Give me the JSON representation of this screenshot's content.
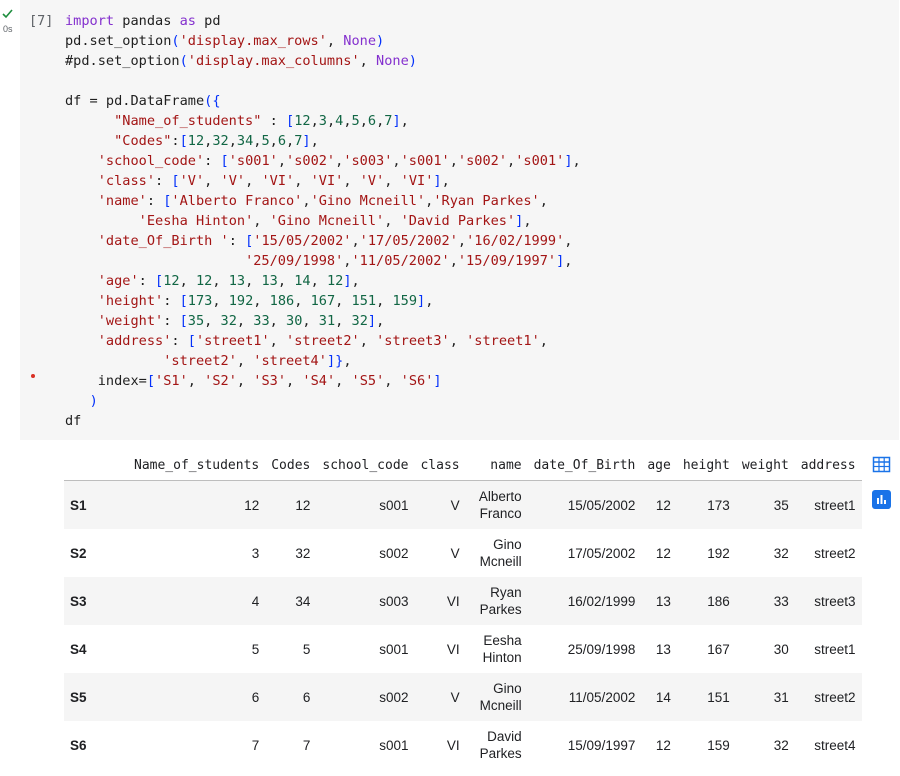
{
  "cell": {
    "status_icon": "check-icon",
    "run_time": "0s",
    "execution_count": "[7]",
    "code_lines": [
      "import pandas as pd",
      "pd.set_option('display.max_rows', None)",
      "#pd.set_option('display.max_columns', None)",
      "",
      "df = pd.DataFrame({",
      "      \"Name_of_students\" : [12,3,4,5,6,7],",
      "      \"Codes\":[12,32,34,5,6,7],",
      "    'school_code': ['s001','s002','s003','s001','s002','s001'],",
      "    'class': ['V', 'V', 'VI', 'VI', 'V', 'VI'],",
      "    'name': ['Alberto Franco','Gino Mcneill','Ryan Parkes',",
      "         'Eesha Hinton', 'Gino Mcneill', 'David Parkes'],",
      "    'date_Of_Birth ': ['15/05/2002','17/05/2002','16/02/1999',",
      "                      '25/09/1998','11/05/2002','15/09/1997'],",
      "    'age': [12, 12, 13, 13, 14, 12],",
      "    'height': [173, 192, 186, 167, 151, 159],",
      "    'weight': [35, 32, 33, 30, 31, 32],",
      "    'address': ['street1', 'street2', 'street3', 'street1',",
      "            'street2', 'street4']},",
      "    index=['S1', 'S2', 'S3', 'S4', 'S5', 'S6']",
      "   )",
      "df"
    ]
  },
  "output": {
    "columns": [
      "Name_of_students",
      "Codes",
      "school_code",
      "class",
      "name",
      "date_Of_Birth",
      "age",
      "height",
      "weight",
      "address"
    ],
    "rows": [
      {
        "index": "S1",
        "cells": [
          "12",
          "12",
          "s001",
          "V",
          "Alberto Franco",
          "15/05/2002",
          "12",
          "173",
          "35",
          "street1"
        ]
      },
      {
        "index": "S2",
        "cells": [
          "3",
          "32",
          "s002",
          "V",
          "Gino Mcneill",
          "17/05/2002",
          "12",
          "192",
          "32",
          "street2"
        ]
      },
      {
        "index": "S3",
        "cells": [
          "4",
          "34",
          "s003",
          "VI",
          "Ryan Parkes",
          "16/02/1999",
          "13",
          "186",
          "33",
          "street3"
        ]
      },
      {
        "index": "S4",
        "cells": [
          "5",
          "5",
          "s001",
          "VI",
          "Eesha Hinton",
          "25/09/1998",
          "13",
          "167",
          "30",
          "street1"
        ]
      },
      {
        "index": "S5",
        "cells": [
          "6",
          "6",
          "s002",
          "V",
          "Gino Mcneill",
          "11/05/2002",
          "14",
          "151",
          "31",
          "street2"
        ]
      },
      {
        "index": "S6",
        "cells": [
          "7",
          "7",
          "s001",
          "VI",
          "David Parkes",
          "15/09/1997",
          "12",
          "159",
          "32",
          "street4"
        ]
      }
    ],
    "side_icons": [
      "table-icon",
      "chart-icon"
    ]
  },
  "colors": {
    "keyword": "#8430ce",
    "string": "#a31515",
    "number": "#116644",
    "bracket": "#0431fa",
    "accent": "#1a73e8",
    "success": "#1e8e3e",
    "lint": "#d93025"
  }
}
